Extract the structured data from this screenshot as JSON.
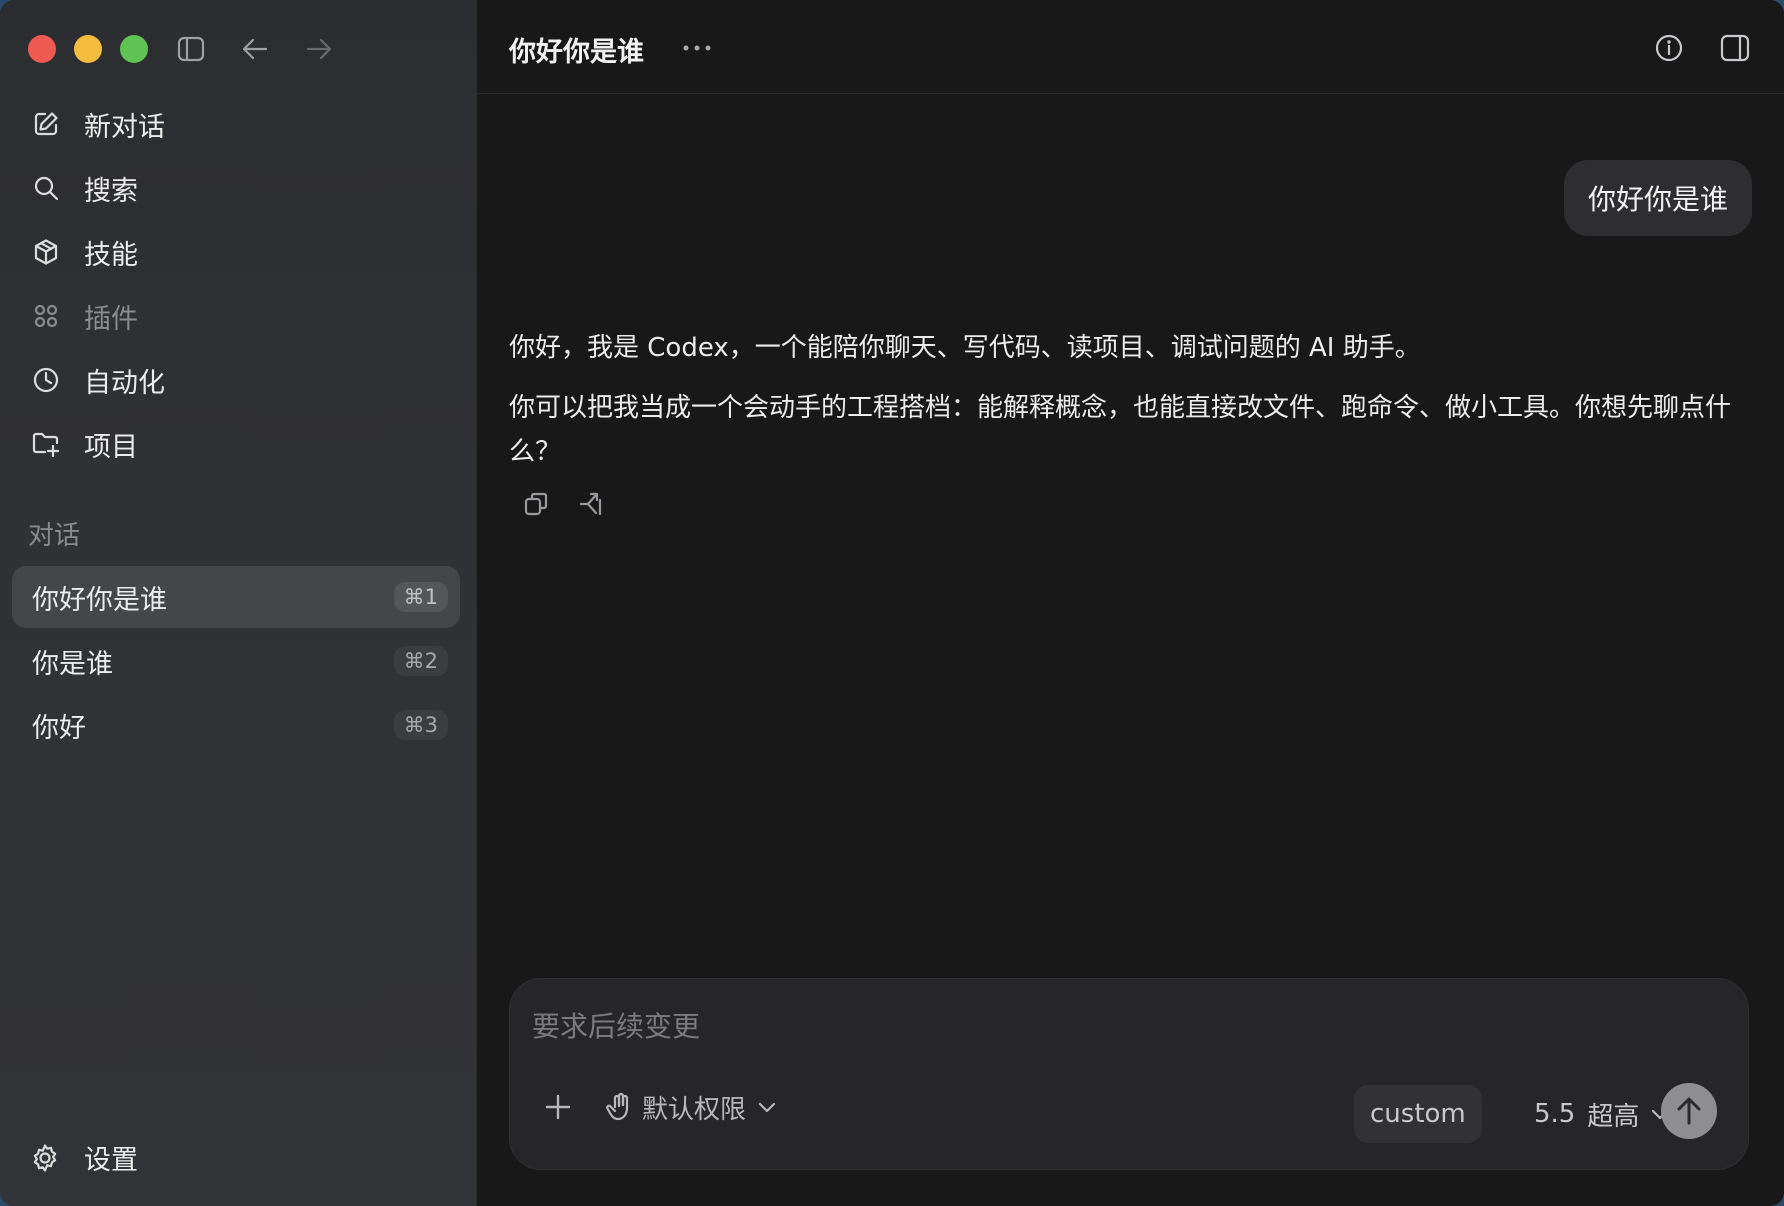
{
  "sidebar": {
    "nav": {
      "new_chat": "新对话",
      "search": "搜索",
      "skills": "技能",
      "plugins": "插件",
      "automation": "自动化",
      "projects": "项目"
    },
    "section_label": "对话",
    "conversations": [
      {
        "title": "你好你是谁",
        "shortcut": "⌘1",
        "active": true
      },
      {
        "title": "你是谁",
        "shortcut": "⌘2",
        "active": false
      },
      {
        "title": "你好",
        "shortcut": "⌘3",
        "active": false
      }
    ],
    "settings_label": "设置"
  },
  "header": {
    "title": "你好你是谁",
    "icons": [
      "more-icon",
      "info-icon",
      "panel-toggle-icon"
    ]
  },
  "chat": {
    "user_message": "你好你是谁",
    "assistant_paragraphs": [
      "你好，我是 Codex，一个能陪你聊天、写代码、读项目、调试问题的 AI 助手。",
      "你可以把我当成一个会动手的工程搭档：能解释概念，也能直接改文件、跑命令、做小工具。你想先聊点什么？"
    ]
  },
  "composer": {
    "placeholder": "要求后续变更",
    "value": "",
    "permission_label": "默认权限",
    "custom_label": "custom",
    "model_version": "5.5",
    "model_effort": "超高"
  },
  "colors": {
    "traffic_red": "#ee5a52",
    "traffic_yellow": "#f4bd3d",
    "traffic_green": "#5fc454",
    "main_bg": "#181818",
    "sidebar_bg": "#2c2d30"
  }
}
